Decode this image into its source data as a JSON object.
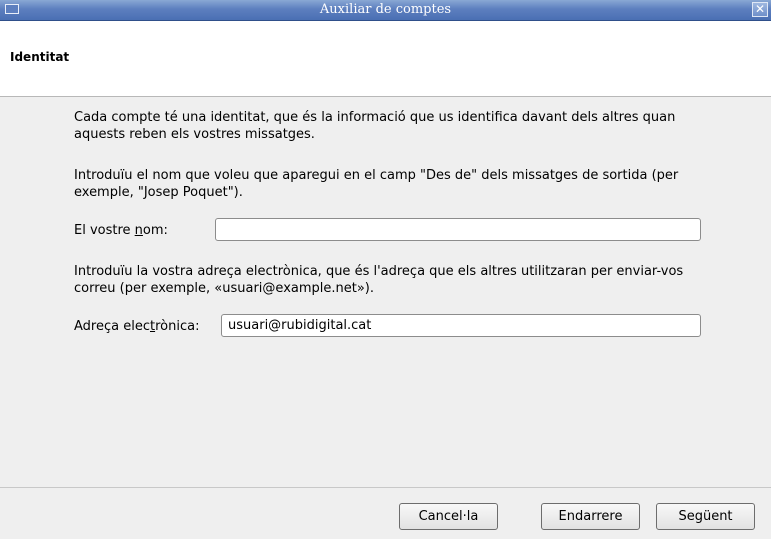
{
  "window": {
    "title": "Auxiliar de comptes",
    "close_glyph": "✕"
  },
  "header": {
    "title": "Identitat"
  },
  "main": {
    "intro_paragraph": "Cada compte té una identitat, que és la informació que us identifica davant dels altres quan aquests reben els vostres missatges.",
    "name_instructions": "Introduïu el nom que voleu que aparegui en el camp \"Des de\" dels missatges de sortida (per exemple, \"Josep Poquet\").",
    "name_label_before": "El vostre ",
    "name_label_mnemonic": "n",
    "name_label_after": "om:",
    "name_value": "",
    "email_instructions": "Introduïu la vostra adreça electrònica, que és l'adreça que els altres utilitzaran per enviar-vos correu (per exemple, «usuari@example.net»).",
    "email_label_before": "Adreça elec",
    "email_label_mnemonic": "t",
    "email_label_after": "rònica:",
    "email_value": "usuari@rubidigital.cat"
  },
  "footer": {
    "cancel_label": "Cancel·la",
    "back_label": "Endarrere",
    "next_label": "Següent"
  },
  "icons": {
    "window_menu": "window-menu-icon",
    "close": "close-icon"
  }
}
